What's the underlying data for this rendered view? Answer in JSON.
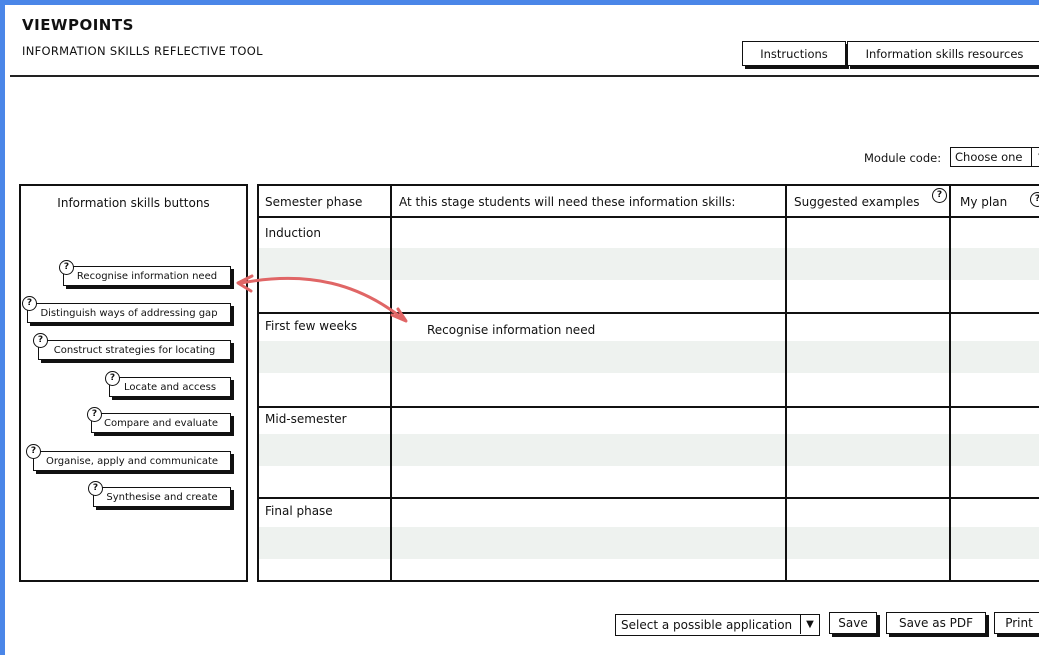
{
  "app": {
    "title": "VIEWPOINTS",
    "subtitle": "INFORMATION SKILLS REFLECTIVE TOOL"
  },
  "header_buttons": {
    "instructions": "Instructions",
    "resources": "Information skills resources"
  },
  "module": {
    "label": "Module code:",
    "selected": "Choose one"
  },
  "skills_panel": {
    "title": "Information skills buttons",
    "help_glyph": "?",
    "buttons": [
      "Recognise information need",
      "Distinguish ways of addressing gap",
      "Construct strategies for locating",
      "Locate and access",
      "Compare and evaluate",
      "Organise, apply and communicate",
      "Synthesise and create"
    ]
  },
  "table": {
    "headers": [
      "Semester phase",
      "At this stage students will need these information skills:",
      "Suggested examples",
      "My plan"
    ],
    "phases": [
      "Induction",
      "First few weeks",
      "Mid-semester",
      "Final phase"
    ],
    "placed_skill": "Recognise information need"
  },
  "footer": {
    "application_select": "Select a possible application",
    "save": "Save",
    "save_pdf": "Save as PDF",
    "print": "Print"
  },
  "colors": {
    "frame": "#4a86e8",
    "arrow": "#e06666",
    "row_band": "#eef2ef"
  },
  "icons": {
    "help": "question-circle-icon",
    "dropdown": "triangle-down-icon",
    "drag_arrow": "curved-arrow-icon"
  }
}
